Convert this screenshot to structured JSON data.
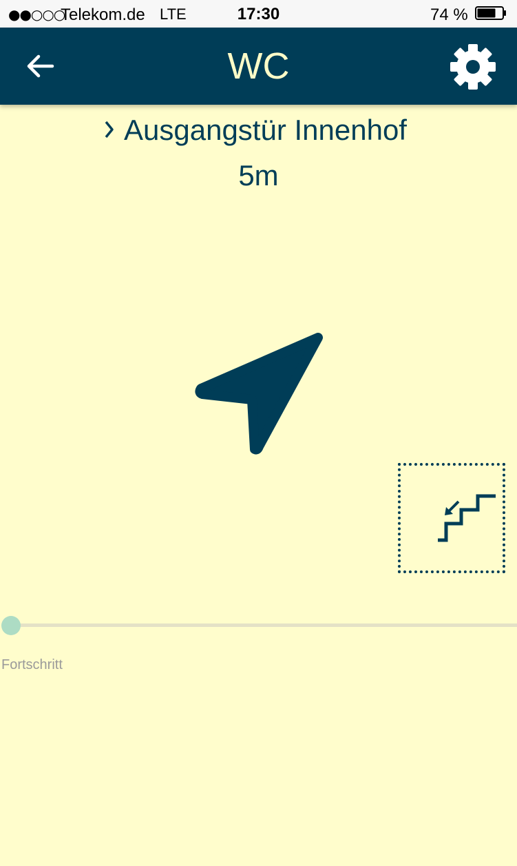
{
  "status_bar": {
    "signal": "●●○○○",
    "carrier": "Telekom.de",
    "network": "LTE",
    "time": "17:30",
    "battery_percent": "74 %",
    "battery_level": 0.74
  },
  "header": {
    "title": "WC",
    "back_icon": "arrow-left-icon",
    "settings_icon": "gear-icon"
  },
  "navigation": {
    "next_waypoint": "Ausgangstür Innenhof",
    "distance": "5m",
    "direction_icon": "navigation-arrow-icon",
    "floor_change_icon": "stairs-down-icon"
  },
  "progress": {
    "label": "Fortschritt",
    "value": 0
  },
  "colors": {
    "primary": "#003d57",
    "background": "#fffdcc",
    "title_text": "#fffcc8",
    "progress_thumb": "#addcc4"
  }
}
